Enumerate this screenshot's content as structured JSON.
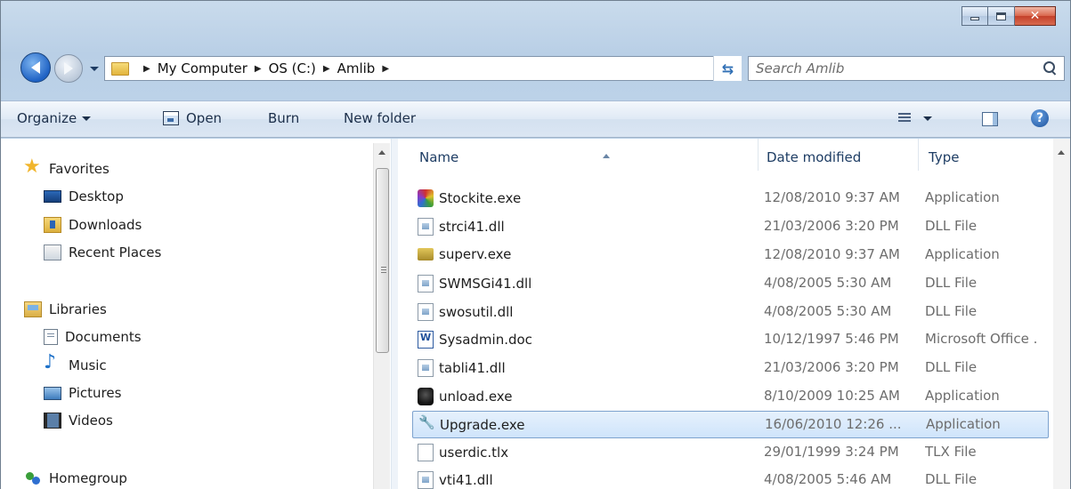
{
  "window": {
    "colors": {
      "frame": "#c9dbec",
      "selection": "#cfe4fb",
      "close": "#c4402a"
    },
    "caption": {
      "minimize_icon": "minimize-icon",
      "maximize_icon": "maximize-icon",
      "close_glyph": "x"
    }
  },
  "address": {
    "breadcrumbs": [
      "My Computer",
      "OS (C:)",
      "Amlib"
    ],
    "search_placeholder": "Search Amlib"
  },
  "toolbar": {
    "organize": "Organize",
    "open": "Open",
    "burn": "Burn",
    "new_folder": "New folder",
    "help": "?"
  },
  "sidebar": {
    "favorites": {
      "label": "Favorites",
      "items": [
        {
          "label": "Desktop",
          "icon": "desktop-icon"
        },
        {
          "label": "Downloads",
          "icon": "downloads-icon"
        },
        {
          "label": "Recent Places",
          "icon": "recent-places-icon"
        }
      ]
    },
    "libraries": {
      "label": "Libraries",
      "items": [
        {
          "label": "Documents",
          "icon": "documents-icon"
        },
        {
          "label": "Music",
          "icon": "music-icon"
        },
        {
          "label": "Pictures",
          "icon": "pictures-icon"
        },
        {
          "label": "Videos",
          "icon": "videos-icon"
        }
      ]
    },
    "homegroup": {
      "label": "Homegroup"
    }
  },
  "file_list": {
    "columns": {
      "name": "Name",
      "date": "Date modified",
      "type": "Type"
    },
    "rows": [
      {
        "name": "Stockite.exe",
        "date": "12/08/2010 9:37 AM",
        "type": "Application",
        "icon": "stockite-exe-icon"
      },
      {
        "name": "strci41.dll",
        "date": "21/03/2006 3:20 PM",
        "type": "DLL File",
        "icon": "dll-file-icon"
      },
      {
        "name": "superv.exe",
        "date": "12/08/2010 9:37 AM",
        "type": "Application",
        "icon": "superv-exe-icon"
      },
      {
        "name": "SWMSGi41.dll",
        "date": "4/08/2005 5:30 AM",
        "type": "DLL File",
        "icon": "dll-file-icon"
      },
      {
        "name": "swosutil.dll",
        "date": "4/08/2005 5:30 AM",
        "type": "DLL File",
        "icon": "dll-file-icon"
      },
      {
        "name": "Sysadmin.doc",
        "date": "10/12/1997 5:46 PM",
        "type": "Microsoft Office .",
        "icon": "word-document-icon"
      },
      {
        "name": "tabli41.dll",
        "date": "21/03/2006 3:20 PM",
        "type": "DLL File",
        "icon": "dll-file-icon"
      },
      {
        "name": "unload.exe",
        "date": "8/10/2009 10:25 AM",
        "type": "Application",
        "icon": "unload-exe-icon"
      },
      {
        "name": "Upgrade.exe",
        "date": "16/06/2010 12:26 ...",
        "type": "Application",
        "icon": "wrench-icon",
        "selected": true
      },
      {
        "name": "userdic.tlx",
        "date": "29/01/1999 3:24 PM",
        "type": "TLX File",
        "icon": "blank-file-icon"
      },
      {
        "name": "vti41.dll",
        "date": "4/08/2005 5:46 AM",
        "type": "DLL File",
        "icon": "dll-file-icon"
      }
    ]
  }
}
